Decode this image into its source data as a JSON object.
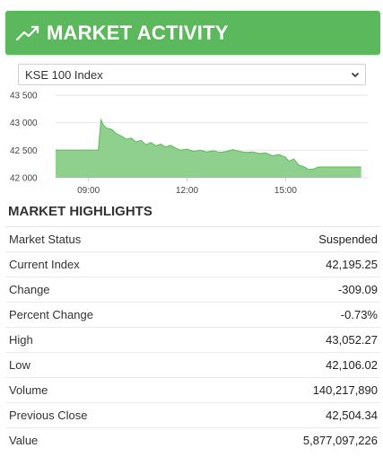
{
  "header": {
    "title": "MARKET ACTIVITY",
    "icon": "trending-up-icon"
  },
  "index_select": {
    "selected": "KSE 100 Index"
  },
  "chart_data": {
    "type": "area",
    "y_ticks": [
      "43 500",
      "43 000",
      "42 500",
      "42 000"
    ],
    "x_ticks": [
      "09:00",
      "12:00",
      "15:00"
    ],
    "ylim": [
      42000,
      43500
    ],
    "x_range_hours": [
      8.0,
      17.5
    ],
    "color": "#5cb85c",
    "fill_color": "#8fd08f",
    "points": [
      [
        8.0,
        42504
      ],
      [
        9.3,
        42504
      ],
      [
        9.38,
        43052
      ],
      [
        9.45,
        42960
      ],
      [
        9.55,
        42900
      ],
      [
        9.7,
        42880
      ],
      [
        9.85,
        42800
      ],
      [
        10.0,
        42760
      ],
      [
        10.15,
        42700
      ],
      [
        10.3,
        42720
      ],
      [
        10.45,
        42650
      ],
      [
        10.6,
        42680
      ],
      [
        10.75,
        42600
      ],
      [
        10.9,
        42640
      ],
      [
        11.05,
        42580
      ],
      [
        11.2,
        42610
      ],
      [
        11.35,
        42560
      ],
      [
        11.5,
        42590
      ],
      [
        11.65,
        42540
      ],
      [
        11.8,
        42500
      ],
      [
        12.0,
        42520
      ],
      [
        12.2,
        42480
      ],
      [
        12.4,
        42500
      ],
      [
        12.6,
        42470
      ],
      [
        12.8,
        42490
      ],
      [
        13.0,
        42460
      ],
      [
        13.2,
        42480
      ],
      [
        13.4,
        42510
      ],
      [
        13.6,
        42480
      ],
      [
        13.8,
        42460
      ],
      [
        14.0,
        42470
      ],
      [
        14.2,
        42440
      ],
      [
        14.4,
        42450
      ],
      [
        14.6,
        42400
      ],
      [
        14.8,
        42420
      ],
      [
        15.0,
        42370
      ],
      [
        15.1,
        42300
      ],
      [
        15.25,
        42340
      ],
      [
        15.4,
        42230
      ],
      [
        15.55,
        42200
      ],
      [
        15.7,
        42150
      ],
      [
        15.85,
        42160
      ],
      [
        16.0,
        42195
      ],
      [
        17.3,
        42195
      ]
    ]
  },
  "highlights": {
    "title": "MARKET HIGHLIGHTS",
    "rows": [
      {
        "label": "Market Status",
        "value": "Suspended"
      },
      {
        "label": "Current Index",
        "value": "42,195.25"
      },
      {
        "label": "Change",
        "value": "-309.09"
      },
      {
        "label": "Percent Change",
        "value": "-0.73%"
      },
      {
        "label": "High",
        "value": "43,052.27"
      },
      {
        "label": "Low",
        "value": "42,106.02"
      },
      {
        "label": "Volume",
        "value": "140,217,890"
      },
      {
        "label": "Previous Close",
        "value": "42,504.34"
      },
      {
        "label": "Value",
        "value": "5,877,097,226"
      }
    ]
  }
}
